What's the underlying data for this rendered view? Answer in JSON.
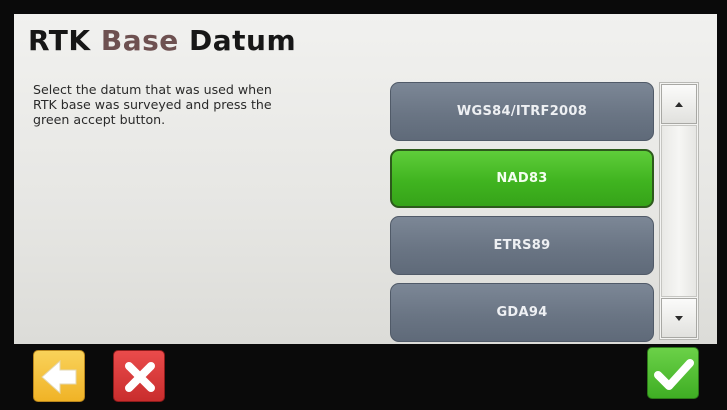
{
  "screen": {
    "title_words": [
      "RTK",
      "Base",
      "Datum"
    ],
    "instructions": [
      "Select the datum that was used when",
      "RTK base was surveyed and press the",
      "green accept button."
    ]
  },
  "datum_list": {
    "options": [
      "WGS84/ITRF2008",
      "NAD83",
      "ETRS89",
      "GDA94"
    ],
    "selected": "NAD83",
    "selected_color": "#40b420",
    "unselected_color": "#6a7584"
  },
  "scrollbar": {
    "up_icon": "scroll-up-arrow-icon",
    "down_icon": "scroll-down-arrow-icon"
  },
  "footer": {
    "back_icon": "arrow-left-icon",
    "back_color": "#f0b326",
    "cancel_icon": "x-icon",
    "cancel_color": "#c92d2d",
    "accept_icon": "checkmark-icon",
    "accept_color": "#3fae24"
  }
}
